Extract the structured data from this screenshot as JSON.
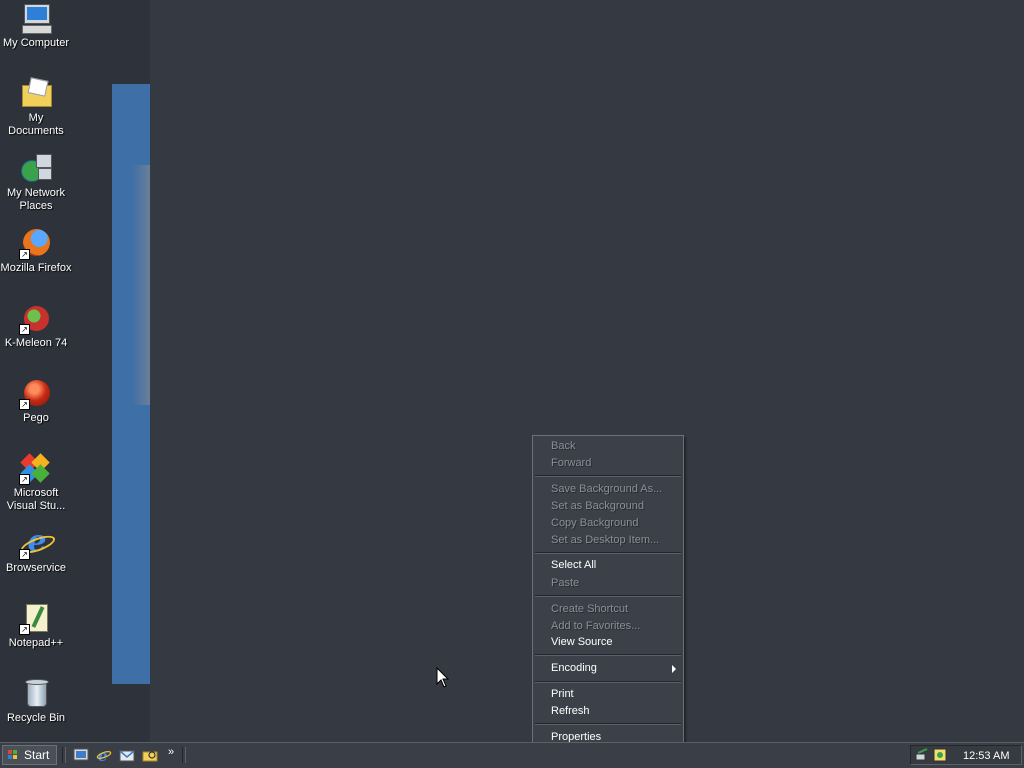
{
  "desktop": {
    "icons": [
      {
        "label": "My Computer"
      },
      {
        "label": "My Documents"
      },
      {
        "label": "My Network Places",
        "label_line1": "My Network",
        "label_line2": "Places"
      },
      {
        "label": "Mozilla Firefox"
      },
      {
        "label": "K-Meleon 74"
      },
      {
        "label": "Pego"
      },
      {
        "label": "Microsoft Visual Stu...",
        "label_line1": "Microsoft",
        "label_line2": "Visual Stu..."
      },
      {
        "label": "Browservice"
      },
      {
        "label": "Notepad++"
      },
      {
        "label": "Recycle Bin"
      }
    ]
  },
  "context_menu": {
    "items": [
      {
        "label": "Back",
        "enabled": false
      },
      {
        "label": "Forward",
        "enabled": false
      },
      {
        "label": "Save Background As...",
        "enabled": false
      },
      {
        "label": "Set as Background",
        "enabled": false
      },
      {
        "label": "Copy Background",
        "enabled": false
      },
      {
        "label": "Set as Desktop Item...",
        "enabled": false
      },
      {
        "label": "Select All",
        "enabled": true
      },
      {
        "label": "Paste",
        "enabled": false
      },
      {
        "label": "Create Shortcut",
        "enabled": false
      },
      {
        "label": "Add to Favorites...",
        "enabled": false
      },
      {
        "label": "View Source",
        "enabled": true
      },
      {
        "label": "Encoding",
        "enabled": true,
        "submenu": true
      },
      {
        "label": "Print",
        "enabled": true
      },
      {
        "label": "Refresh",
        "enabled": true
      },
      {
        "label": "Properties",
        "enabled": true
      }
    ]
  },
  "taskbar": {
    "start_label": "Start",
    "clock": "12:53 AM",
    "more_glyph": "»"
  }
}
